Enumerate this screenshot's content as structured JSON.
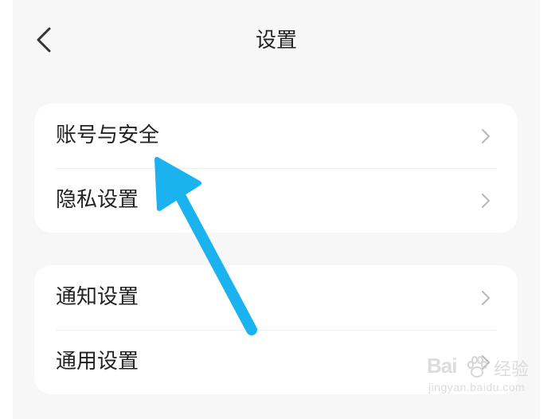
{
  "header": {
    "title": "设置",
    "back_icon": "chevron-left-icon"
  },
  "groups": [
    {
      "items": [
        {
          "label": "账号与安全",
          "icon": "chevron-right-icon"
        },
        {
          "label": "隐私设置",
          "icon": "chevron-right-icon"
        }
      ]
    },
    {
      "items": [
        {
          "label": "通知设置",
          "icon": "chevron-right-icon"
        },
        {
          "label": "通用设置",
          "icon": "chevron-right-icon"
        }
      ]
    }
  ],
  "annotation": {
    "arrow_color": "#1ab3f0"
  },
  "watermark": {
    "logo_text": "Bai",
    "product": "经验",
    "url": "jingyan.baidu.com"
  },
  "colors": {
    "page_background": "#f7f7f7",
    "card_background": "#ffffff",
    "text": "#222222",
    "chevron": "#b8b8b8",
    "divider": "#eeeeee"
  }
}
